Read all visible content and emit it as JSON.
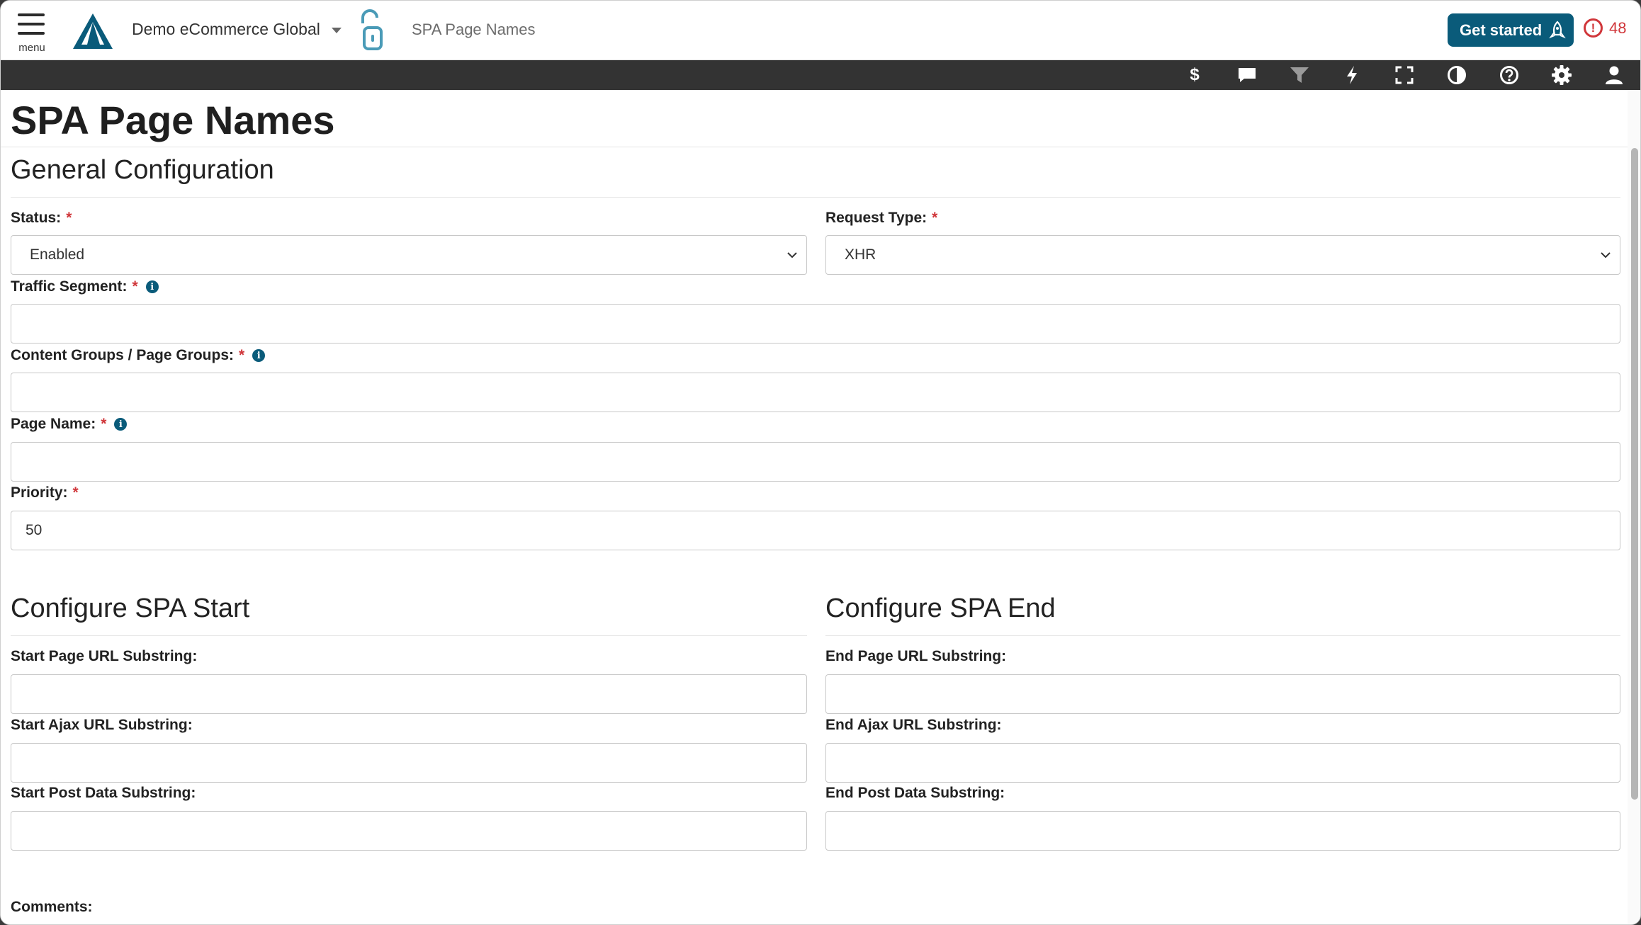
{
  "header": {
    "menu_label": "menu",
    "account_name": "Demo eCommerce Global",
    "breadcrumb_page": "SPA Page Names",
    "get_started_label": "Get started",
    "alert_count": "48",
    "alert_symbol": "!"
  },
  "toolbar": {
    "icons": [
      "dollar-icon",
      "comment-icon",
      "filter-icon",
      "bolt-icon",
      "fullscreen-icon",
      "contrast-icon",
      "help-icon",
      "gear-icon",
      "user-icon"
    ],
    "dollar_symbol": "$"
  },
  "page": {
    "title": "SPA Page Names"
  },
  "general": {
    "section_title": "General Configuration",
    "status_label": "Status:",
    "status_value": "Enabled",
    "request_type_label": "Request Type:",
    "request_type_value": "XHR",
    "traffic_segment_label": "Traffic Segment:",
    "traffic_segment_value": "",
    "content_groups_label": "Content Groups / Page Groups:",
    "content_groups_value": "",
    "page_name_label": "Page Name:",
    "page_name_value": "",
    "priority_label": "Priority:",
    "priority_value": "50",
    "required_mark": "*",
    "info_mark": "i"
  },
  "spa_start": {
    "section_title": "Configure SPA Start",
    "page_url_label": "Start Page URL Substring:",
    "page_url_value": "",
    "ajax_url_label": "Start Ajax URL Substring:",
    "ajax_url_value": "",
    "post_data_label": "Start Post Data Substring:",
    "post_data_value": ""
  },
  "spa_end": {
    "section_title": "Configure SPA End",
    "page_url_label": "End Page URL Substring:",
    "page_url_value": "",
    "ajax_url_label": "End Ajax URL Substring:",
    "ajax_url_value": "",
    "post_data_label": "End Post Data Substring:",
    "post_data_value": ""
  },
  "comments": {
    "label": "Comments:"
  },
  "colors": {
    "brand": "#0a5b7a",
    "alert": "#d0363a",
    "toolbar_bg": "#333333"
  }
}
